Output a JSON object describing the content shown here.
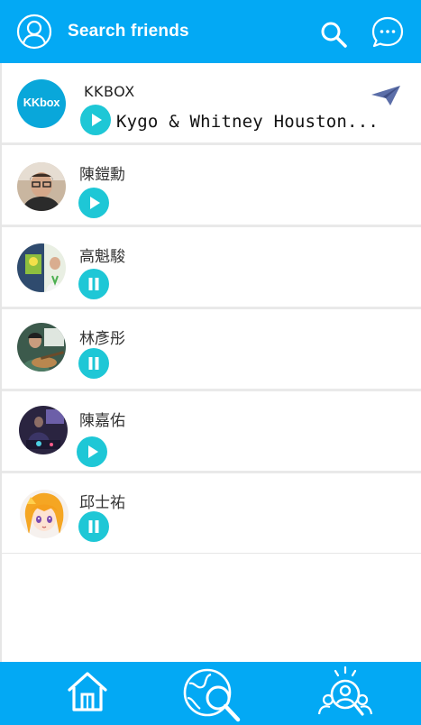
{
  "header": {
    "title": "Search friends"
  },
  "featured": {
    "name": "KKBOX",
    "logo_text": "KKbox",
    "track": "Kygo & Whitney Houston...",
    "state": "paused"
  },
  "friends": [
    {
      "name": "陳鎧勳",
      "state": "play"
    },
    {
      "name": "高魁駿",
      "state": "pause"
    },
    {
      "name": "林彥彤",
      "state": "pause"
    },
    {
      "name": "陳嘉佑",
      "state": "play"
    },
    {
      "name": "邱士祐",
      "state": "pause"
    }
  ],
  "colors": {
    "primary": "#03a9f4",
    "accent": "#1ec7d6",
    "send": "#5b6ea8"
  },
  "nav": {
    "items": [
      "home-icon",
      "explore-icon",
      "friends-search-icon"
    ]
  }
}
